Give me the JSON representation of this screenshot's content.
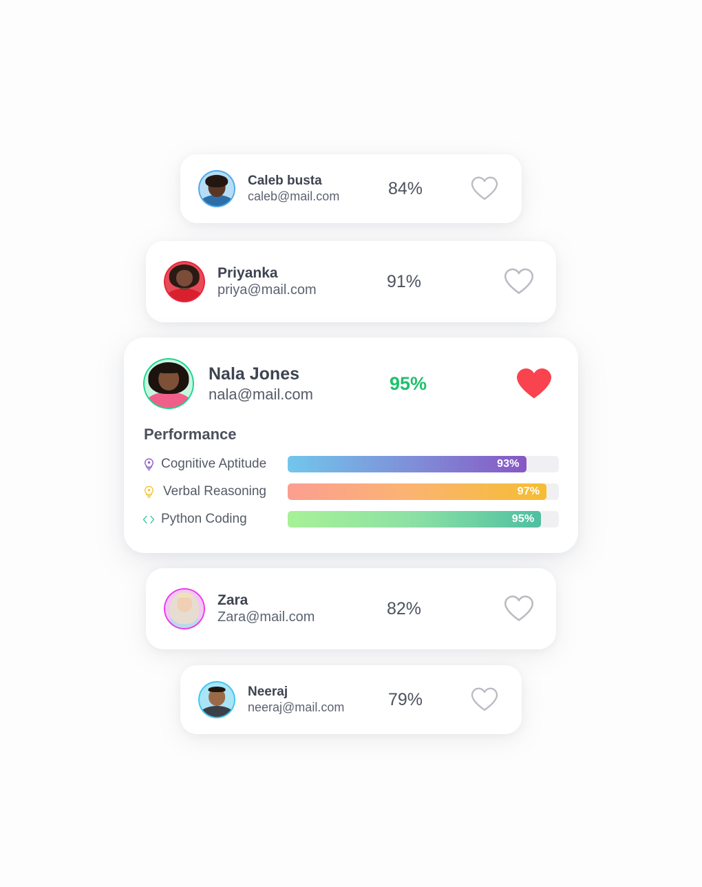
{
  "background_color": "#fdfdfd",
  "candidates": [
    {
      "id": "caleb",
      "name": "Caleb busta",
      "email": "caleb@mail.com",
      "score": "84%",
      "favorited": false,
      "avatar_ring_color": "#4fa8e8",
      "avatar_bg_color": "#b6ddf5"
    },
    {
      "id": "priyanka",
      "name": "Priyanka",
      "email": "priya@mail.com",
      "score": "91%",
      "favorited": false,
      "avatar_ring_color": "#e8263c",
      "avatar_bg_color": "#e84a56"
    },
    {
      "id": "zara",
      "name": "Zara",
      "email": "Zara@mail.com",
      "score": "82%",
      "favorited": false,
      "avatar_ring_color": "#e83ce8",
      "avatar_bg_color": "#f4c6f4"
    },
    {
      "id": "neeraj",
      "name": "Neeraj",
      "email": "neeraj@mail.com",
      "score": "79%",
      "favorited": false,
      "avatar_ring_color": "#3fc6ef",
      "avatar_bg_color": "#a9e4f7"
    }
  ],
  "featured": {
    "id": "nala",
    "name": "Nala Jones",
    "email": "nala@mail.com",
    "score": "95%",
    "score_color": "#1ec16b",
    "favorited": true,
    "favorite_color": "#f9434f",
    "avatar_ring_color": "#19d48a",
    "avatar_bg_color": "#c9f5e0",
    "performance": {
      "title": "Performance",
      "rows": [
        {
          "icon": "lightbulb-icon",
          "icon_color": "#8b5fc9",
          "label": "Cognitive Aptitude",
          "value": "93%",
          "value_number": 93,
          "gradient_from": "#72c6ec",
          "gradient_to": "#8757c4"
        },
        {
          "icon": "lightbulb-icon",
          "icon_color": "#f5c434",
          "label": "Verbal Reasoning",
          "value": "97%",
          "value_number": 97,
          "gradient_from": "#fb9e90",
          "gradient_to": "#f5bd33"
        },
        {
          "icon": "code-brackets-icon",
          "icon_color": "#43c9a5",
          "label": "Python Coding",
          "value": "95%",
          "value_number": 95,
          "gradient_from": "#a7f197",
          "gradient_to": "#4ebfa1"
        }
      ]
    }
  },
  "icons": {
    "heart_outline": "heart-outline-icon",
    "heart_filled": "heart-filled-icon",
    "heart_outline_color": "#b9bcc2"
  },
  "chart_data": {
    "type": "bar",
    "title": "Performance",
    "orientation": "horizontal",
    "categories": [
      "Cognitive Aptitude",
      "Verbal Reasoning",
      "Python Coding"
    ],
    "values": [
      93,
      97,
      95
    ],
    "value_labels": [
      "93%",
      "97%",
      "95%"
    ],
    "xlabel": "",
    "ylabel": "",
    "xlim": [
      0,
      100
    ],
    "grid": false,
    "legend": "none",
    "track_color": "#f0f0f2",
    "series_colors": [
      [
        "#72c6ec",
        "#8757c4"
      ],
      [
        "#fb9e90",
        "#f5bd33"
      ],
      [
        "#a7f197",
        "#4ebfa1"
      ]
    ]
  }
}
